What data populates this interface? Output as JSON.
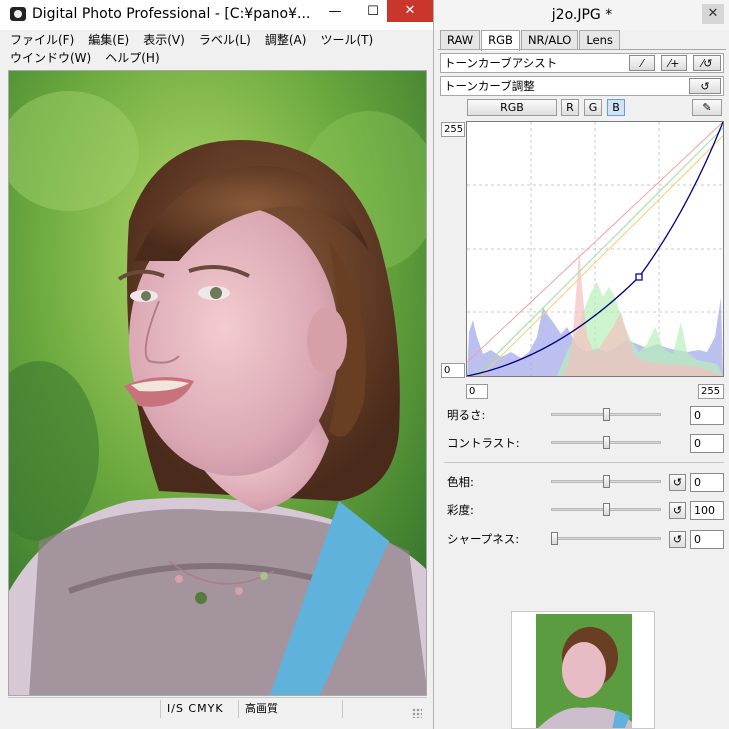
{
  "main": {
    "title": "Digital Photo Professional - [C:¥pano¥...",
    "minimize": "—",
    "maximize": "☐",
    "close": "✕",
    "menus_row1": [
      "ファイル(F)",
      "編集(E)",
      "表示(V)",
      "ラベル(L)",
      "調整(A)",
      "ツール(T)"
    ],
    "menus_row2": [
      "ウインドウ(W)",
      "ヘルプ(H)"
    ],
    "status": {
      "mode": "I/S CMYK",
      "quality": "高画質"
    }
  },
  "palette": {
    "title": "j2o.JPG *",
    "close": "✕",
    "tabs": [
      "RAW",
      "RGB",
      "NR/ALO",
      "Lens"
    ],
    "active_tab": "RGB",
    "tone_assist_label": "トーンカーブアシスト",
    "tone_adjust_label": "トーンカーブ調整",
    "channels": [
      "RGB",
      "R",
      "G",
      "B"
    ],
    "selected_channel": "B",
    "curve": {
      "y_max": "255",
      "y_min": "0",
      "x_min": "0",
      "x_max": "255"
    },
    "sliders": [
      {
        "label": "明るさ:",
        "value": "0",
        "position": 0.5
      },
      {
        "label": "コントラスト:",
        "value": "0",
        "position": 0.5
      },
      {
        "label": "色相:",
        "value": "0",
        "position": 0.5
      },
      {
        "label": "彩度:",
        "value": "100",
        "position": 0.5
      },
      {
        "label": "シャープネス:",
        "value": "0",
        "position": 0.0
      }
    ]
  },
  "colors": {
    "close_red": "#c8362c",
    "curve_blue": "#000080",
    "selected_channel": "#cfe3f7"
  }
}
